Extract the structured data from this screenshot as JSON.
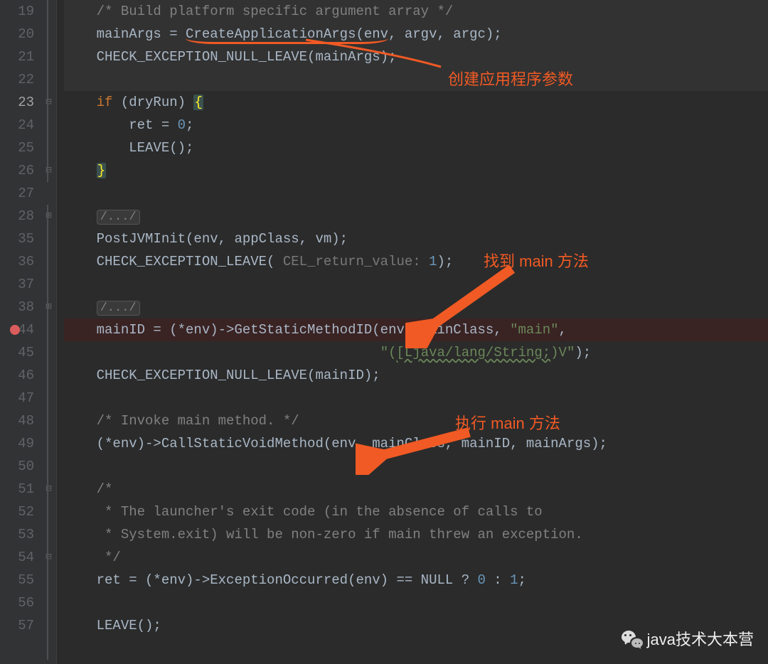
{
  "gutter": {
    "lines": [
      "19",
      "20",
      "21",
      "22",
      "23",
      "24",
      "25",
      "26",
      "27",
      "28",
      "35",
      "36",
      "37",
      "38",
      "44",
      "45",
      "46",
      "47",
      "48",
      "49",
      "50",
      "51",
      "52",
      "53",
      "54",
      "55",
      "56",
      "57"
    ],
    "current": "23",
    "breakpoint_at": "44"
  },
  "fold": {
    "marks": {
      "4": "⊟",
      "7": "⊟",
      "9": "⊞",
      "13": "⊞",
      "21": "⊟",
      "24": "⊟"
    }
  },
  "code": {
    "l0": "    /* Build platform specific argument array */",
    "l1a": "    mainArgs = ",
    "l1b": "CreateApplicationArgs(env",
    "l1c": ", argv, argc);",
    "l2": "    CHECK_EXCEPTION_NULL_LEAVE(mainArgs);",
    "l4a": "    ",
    "l4b": "if",
    "l4c": " (dryRun) ",
    "l4d": "{",
    "l5a": "        ret = ",
    "l5b": "0",
    "l5c": ";",
    "l6": "        LEAVE();",
    "l7": "    ",
    "l7b": "}",
    "l9a": "    ",
    "l9b": "/.../",
    "l10": "    PostJVMInit(env, appClass, vm);",
    "l11a": "    CHECK_EXCEPTION_LEAVE( ",
    "l11h": "CEL_return_value: ",
    "l11b": "1",
    "l11c": ");",
    "l13a": "    ",
    "l13b": "/.../",
    "l14a": "    mainID = (*env)->GetStaticMethodID(env, mainClass, ",
    "l14b": "\"main\"",
    "l14c": ",",
    "l15a": "                                       ",
    "l15b": "\"(",
    "l15c": "[Ljava/lang/String;",
    "l15d": ")V\"",
    "l15e": ");",
    "l16": "    CHECK_EXCEPTION_NULL_LEAVE(mainID);",
    "l18": "    /* Invoke main method. */",
    "l19": "    (*env)->CallStaticVoidMethod(env, mainClass, mainID, mainArgs);",
    "l21": "    /*",
    "l22": "     * The launcher's exit code (in the absence of calls to",
    "l23": "     * System.exit) will be non-zero if main threw an exception.",
    "l24": "     */",
    "l25a": "    ret = (*env)->ExceptionOccurred(env) == NULL ? ",
    "l25b": "0",
    "l25c": " : ",
    "l25d": "1",
    "l25e": ";",
    "l27": "    LEAVE();"
  },
  "annotations": {
    "a1": "创建应用程序参数",
    "a2": "找到 main 方法",
    "a3": "执行 main 方法"
  },
  "watermark": "java技术大本营"
}
